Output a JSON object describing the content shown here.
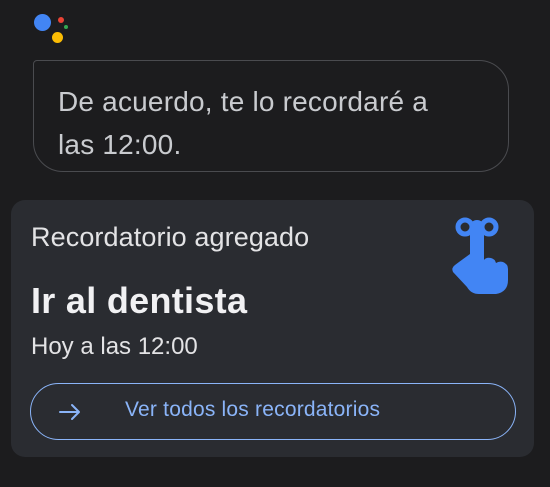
{
  "assistant": {
    "logo_icon": "google-assistant-icon",
    "colors": {
      "blue": "#4285f4",
      "red": "#ea4335",
      "yellow": "#fbbc04",
      "green": "#34a853"
    }
  },
  "message": {
    "text_line_1": "De acuerdo, te lo recordaré a",
    "text_line_2": "las 12:00."
  },
  "reminder_card": {
    "header": "Recordatorio agregado",
    "title": "Ir al dentista",
    "time": "Hoy a las 12:00",
    "icon": "reminder-finger-icon",
    "button": {
      "label": "Ver todos los recordatorios",
      "icon": "arrow-right-icon"
    },
    "accent_color": "#8ab4f8",
    "icon_color": "#4285f4"
  }
}
